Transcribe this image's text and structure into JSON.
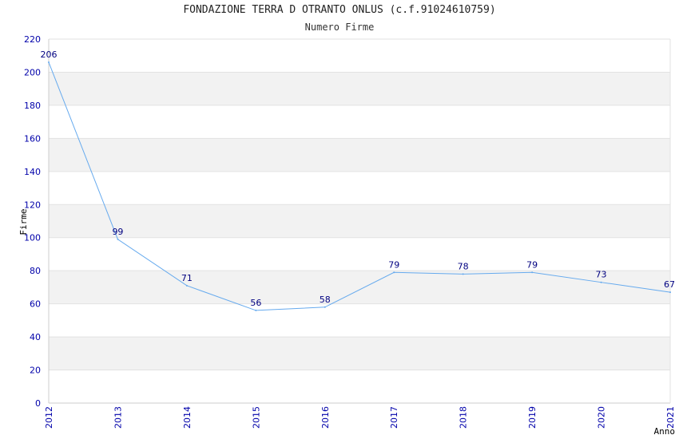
{
  "chart_data": {
    "type": "line",
    "title": "FONDAZIONE TERRA D OTRANTO ONLUS (c.f.91024610759)",
    "subtitle": "Numero Firme",
    "xlabel": "Anno",
    "ylabel": "Firme",
    "x": [
      "2012",
      "2013",
      "2014",
      "2015",
      "2016",
      "2017",
      "2018",
      "2019",
      "2020",
      "2021"
    ],
    "series": [
      {
        "values": [
          206,
          99,
          71,
          56,
          58,
          79,
          78,
          79,
          73,
          67
        ]
      }
    ],
    "ylim": [
      0,
      220
    ],
    "yticks": [
      0,
      20,
      40,
      60,
      80,
      100,
      120,
      140,
      160,
      180,
      200,
      220
    ],
    "grid": true,
    "line_color": "#66aaee",
    "band_color": "#f2f2f2",
    "tick_color": "#0000aa",
    "label_color": "#000080"
  }
}
